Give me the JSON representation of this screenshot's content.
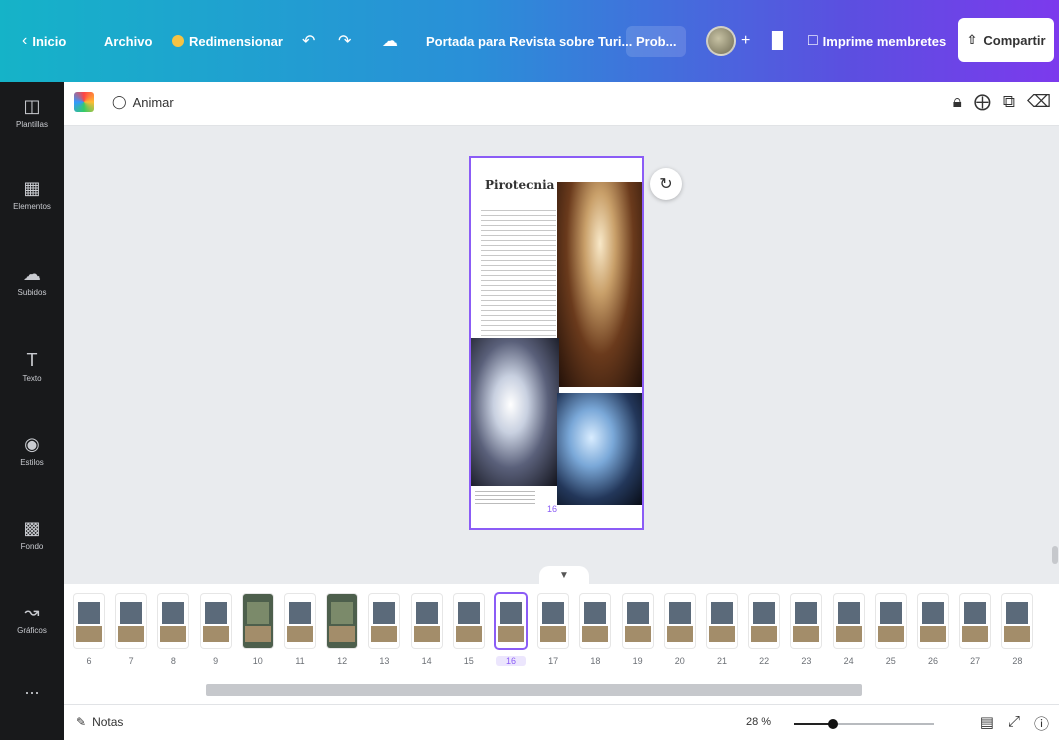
{
  "topbar": {
    "back_icon": "chevron-left-icon",
    "home": "Inicio",
    "file": "Archivo",
    "resize": "Redimensionar",
    "undo_icon": "undo-icon",
    "redo_icon": "redo-icon",
    "saved_icon": "cloud-check-icon",
    "doc_title": "Portada para Revista sobre Turi...",
    "trial": "Prob...",
    "add_member_icon": "plus-icon",
    "analytics_icon": "bar-chart-icon",
    "print": "Imprime membretes",
    "share": "Compartir",
    "accent": "#7c3aed"
  },
  "sidebar": {
    "items": [
      {
        "label": "Plantillas",
        "icon": "template-icon"
      },
      {
        "label": "Elementos",
        "icon": "shapes-icon"
      },
      {
        "label": "Subidos",
        "icon": "upload-cloud-icon"
      },
      {
        "label": "Texto",
        "icon": "text-icon"
      },
      {
        "label": "Estilos",
        "icon": "palette-icon"
      },
      {
        "label": "Fondo",
        "icon": "background-grid-icon"
      },
      {
        "label": "Gráficos",
        "icon": "chart-icon"
      },
      {
        "label": "...",
        "icon": "more-icon"
      }
    ]
  },
  "toolbar": {
    "animate": "Animar",
    "icons": [
      "lock-icon",
      "add-page-icon",
      "duplicate-icon",
      "trash-icon"
    ]
  },
  "canvas": {
    "page_title": "Pirotecnia",
    "page_number": "16"
  },
  "thumbnails": {
    "pages": [
      "6",
      "7",
      "8",
      "9",
      "10",
      "11",
      "12",
      "13",
      "14",
      "15",
      "16",
      "17",
      "18",
      "19",
      "20",
      "21",
      "22",
      "23",
      "24",
      "25",
      "26",
      "27",
      "28"
    ],
    "selected": "16"
  },
  "bottombar": {
    "notes": "Notas",
    "zoom": "28 %",
    "zoom_level": 0.28
  }
}
